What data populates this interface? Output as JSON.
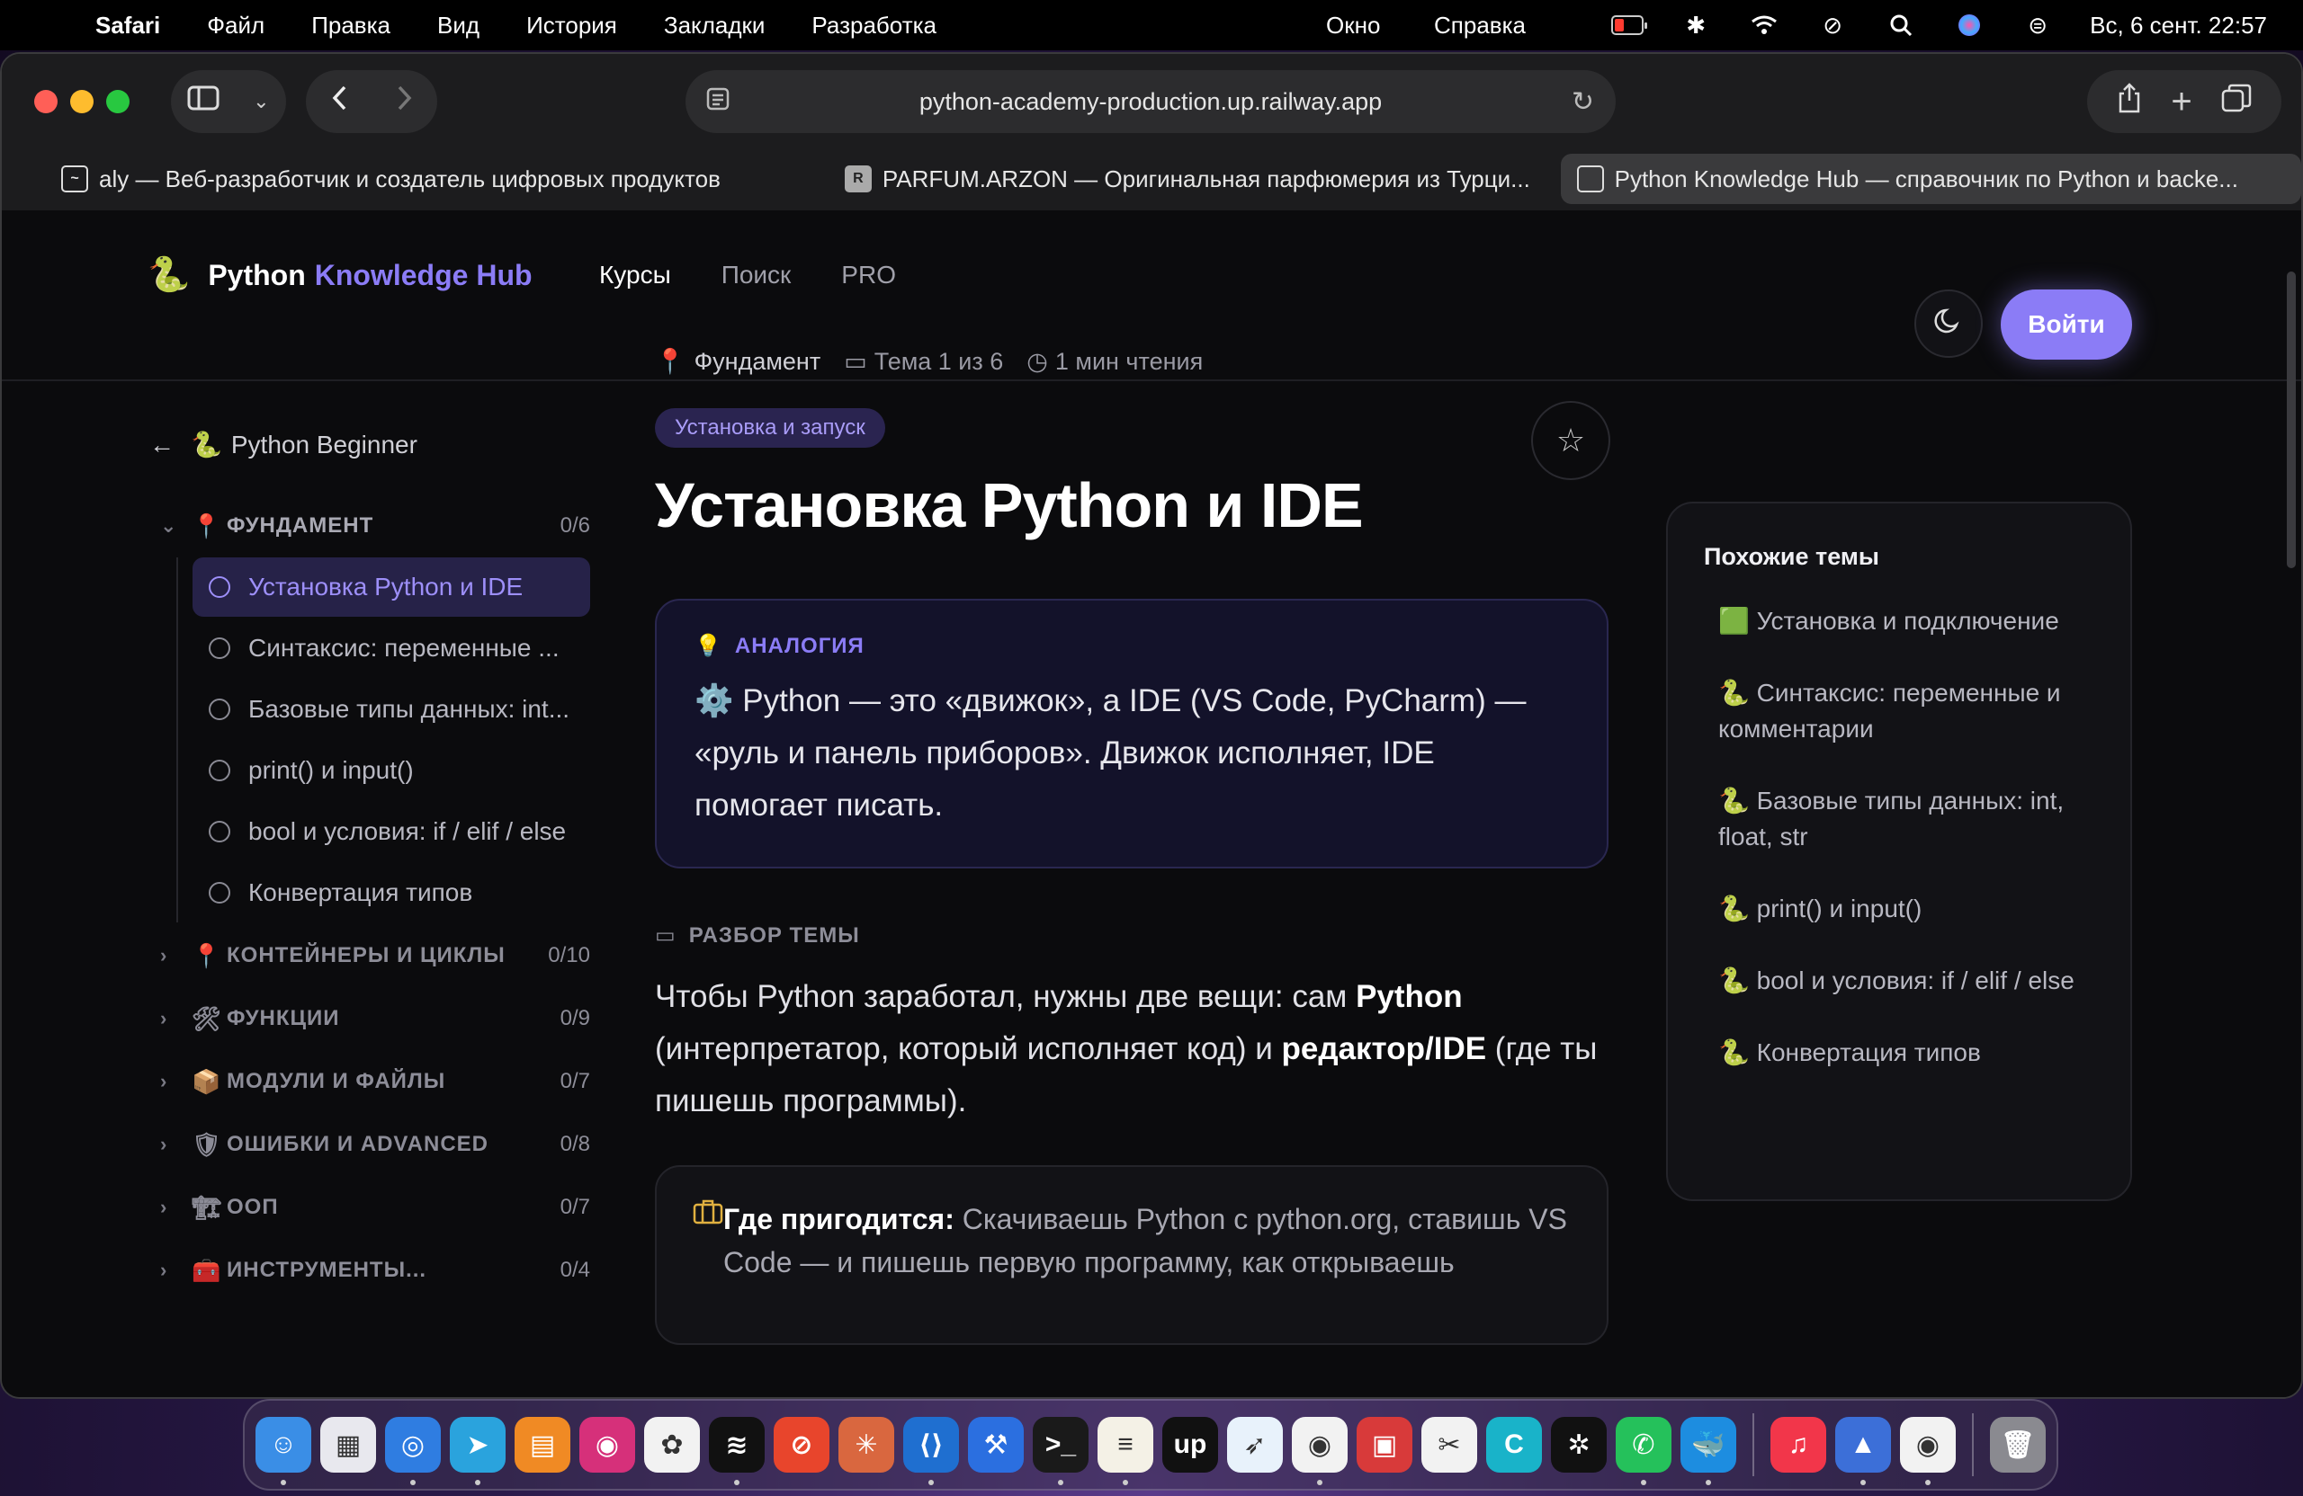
{
  "menubar": {
    "app": "Safari",
    "items": [
      "Файл",
      "Правка",
      "Вид",
      "История",
      "Закладки",
      "Разработка"
    ],
    "right_items": [
      "Окно",
      "Справка"
    ],
    "datetime": "Вс, 6 сент.  22:57"
  },
  "browser": {
    "url": "python-academy-production.up.railway.app",
    "tabs": [
      {
        "label": "aly — Веб-разработчик и создатель цифровых продуктов",
        "fav": "~"
      },
      {
        "label": "PARFUM.ARZON — Оригинальная парфюмерия из Турци...",
        "fav": "R"
      },
      {
        "label": "Python Knowledge Hub — справочник по Python и backe...",
        "fav": ""
      }
    ]
  },
  "site": {
    "logo_primary": "Python",
    "logo_accent": "Knowledge Hub",
    "nav": [
      "Курсы",
      "Поиск",
      "PRO"
    ],
    "login": "Войти"
  },
  "sidebar": {
    "back": "Python Beginner",
    "sections": [
      {
        "emoji": "📍",
        "label": "ФУНДАМЕНТ",
        "count": "0/6",
        "open": true,
        "items": [
          "Установка Python и IDE",
          "Синтаксис: переменные ...",
          "Базовые типы данных: int...",
          "print() и input()",
          "bool и условия: if / elif / else",
          "Конвертация типов"
        ]
      },
      {
        "emoji": "📍",
        "label": "КОНТЕЙНЕРЫ И ЦИКЛЫ",
        "count": "0/10"
      },
      {
        "emoji": "🛠",
        "label": "ФУНКЦИИ",
        "count": "0/9"
      },
      {
        "emoji": "📦",
        "label": "МОДУЛИ И ФАЙЛЫ",
        "count": "0/7"
      },
      {
        "emoji": "🛡",
        "label": "ОШИБКИ И ADVANCED",
        "count": "0/8"
      },
      {
        "emoji": "🏗",
        "label": "ООП",
        "count": "0/7"
      },
      {
        "emoji": "🧰",
        "label": "ИНСТРУМЕНТЫ...",
        "count": "0/4"
      }
    ]
  },
  "main": {
    "meta_section": "Фундамент",
    "meta_topic": "Тема 1 из 6",
    "meta_time": "1 мин чтения",
    "pill": "Установка и запуск",
    "title": "Установка Python и IDE",
    "analogy_tag": "АНАЛОГИЯ",
    "analogy_text": "⚙️ Python — это «движок», а IDE (VS Code, PyCharm) — «руль и панель приборов». Движок исполняет, IDE помогает писать.",
    "breakdown_title": "РАЗБОР ТЕМЫ",
    "breakdown_p1": "Чтобы Python заработал, нужны две вещи: сам ",
    "breakdown_b1": "Python",
    "breakdown_p2": " (интерпретатор, который исполняет код) и ",
    "breakdown_b2": "редактор/IDE",
    "breakdown_p3": " (где ты пишешь программы).",
    "usage_label": "Где пригодится:",
    "usage_text": " Скачиваешь Python с python.org, ставишь VS Code — и пишешь первую программу, как открываешь"
  },
  "related": {
    "title": "Похожие темы",
    "items": [
      "🟩 Установка и подключение",
      "🐍 Синтаксис: переменные и комментарии",
      "🐍 Базовые типы данных: int, float, str",
      "🐍 print() и input()",
      "🐍 bool и условия: if / elif / else",
      "🐍 Конвертация типов"
    ]
  },
  "dock": {
    "apps": [
      {
        "name": "finder",
        "color": "#3a8ee6",
        "glyph": "☺"
      },
      {
        "name": "launchpad",
        "color": "#e8e8ee",
        "glyph": "▦"
      },
      {
        "name": "safari",
        "color": "#2f7de1",
        "glyph": "◎"
      },
      {
        "name": "telegram",
        "color": "#2aa3dd",
        "glyph": "➤"
      },
      {
        "name": "books",
        "color": "#f08a24",
        "glyph": "▤"
      },
      {
        "name": "instagram",
        "color": "#d6307a",
        "glyph": "◉"
      },
      {
        "name": "photos",
        "color": "#f2f2f2",
        "glyph": "✿"
      },
      {
        "name": "spotify",
        "color": "#111",
        "glyph": "≋"
      },
      {
        "name": "screen-recorder",
        "color": "#e8452c",
        "glyph": "⊘"
      },
      {
        "name": "claude",
        "color": "#d9673f",
        "glyph": "✳"
      },
      {
        "name": "vscode",
        "color": "#1f6fd0",
        "glyph": "⟨⟩"
      },
      {
        "name": "xcode",
        "color": "#2b6fe0",
        "glyph": "⚒"
      },
      {
        "name": "terminal",
        "color": "#1a1a1a",
        "glyph": ">_"
      },
      {
        "name": "notes",
        "color": "#f4f1e6",
        "glyph": "≡"
      },
      {
        "name": "upwork",
        "color": "#111",
        "glyph": "up"
      },
      {
        "name": "migrate",
        "color": "#e8f2fb",
        "glyph": "➶"
      },
      {
        "name": "chrome",
        "color": "#f2f2f2",
        "glyph": "◉"
      },
      {
        "name": "archiver",
        "color": "#d83a3a",
        "glyph": "▣"
      },
      {
        "name": "capcut",
        "color": "#f2f2f2",
        "glyph": "✂"
      },
      {
        "name": "canva",
        "color": "#19b3c9",
        "glyph": "C"
      },
      {
        "name": "chatgpt",
        "color": "#111",
        "glyph": "✲"
      },
      {
        "name": "whatsapp",
        "color": "#25c15b",
        "glyph": "✆"
      },
      {
        "name": "docker",
        "color": "#1d8de0",
        "glyph": "🐳"
      },
      {
        "name": "music",
        "color": "#f2364a",
        "glyph": "♫"
      },
      {
        "name": "finder-alt",
        "color": "#3c6fd8",
        "glyph": "▲"
      },
      {
        "name": "chrome-alt",
        "color": "#f2f2f2",
        "glyph": "◉"
      },
      {
        "name": "trash",
        "color": "#8a8a90",
        "glyph": "🗑"
      }
    ]
  }
}
